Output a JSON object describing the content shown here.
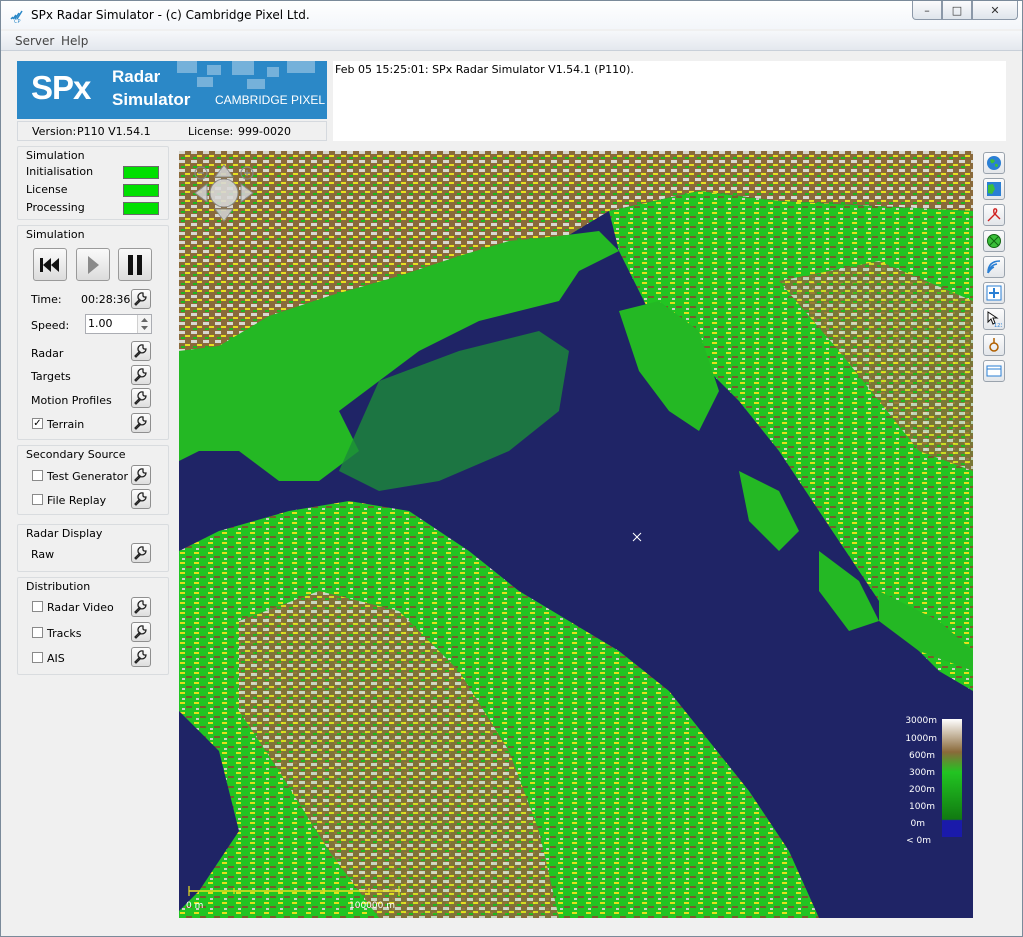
{
  "window": {
    "title": "SPx Radar Simulator - (c) Cambridge Pixel Ltd."
  },
  "menu": {
    "items": [
      "Server",
      "Help"
    ]
  },
  "logo": {
    "spx": "SPx",
    "line1": "Radar",
    "line2": "Simulator",
    "company": "CAMBRIDGE PIXEL"
  },
  "version": {
    "version_label": "Version:",
    "version_value": "P110 V1.54.1",
    "license_label": "License:",
    "license_value": "999-0020"
  },
  "log": {
    "lines": [
      "Feb 05 15:25:01: SPx Radar Simulator V1.54.1 (P110)."
    ]
  },
  "status": {
    "title": "Simulation",
    "items": [
      {
        "label": "Initialisation",
        "color": "#00e000"
      },
      {
        "label": "License",
        "color": "#00e000"
      },
      {
        "label": "Processing",
        "color": "#00e000"
      }
    ]
  },
  "simulation": {
    "title": "Simulation",
    "time_label": "Time:",
    "time_value": "00:28:36",
    "speed_label": "Speed:",
    "speed_value": "1.00",
    "radar_label": "Radar",
    "targets_label": "Targets",
    "motion_label": "Motion Profiles",
    "terrain_label": "Terrain",
    "terrain_checked": true
  },
  "secondary": {
    "title": "Secondary Source",
    "test_label": "Test Generator",
    "file_label": "File Replay"
  },
  "display": {
    "title": "Radar Display",
    "raw_label": "Raw"
  },
  "distribution": {
    "title": "Distribution",
    "video_label": "Radar Video",
    "tracks_label": "Tracks",
    "ais_label": "AIS"
  },
  "legend": {
    "labels": [
      "3000m",
      "1000m",
      "600m",
      "300m",
      "200m",
      "100m",
      "0m",
      "< 0m"
    ]
  },
  "scale": {
    "start": "0 m",
    "end": "100000 m"
  },
  "colors": {
    "sea": "#1f2466",
    "land_low": "#1fc21f",
    "land_mid": "#7a5c2e",
    "land_high": "#c8c8c0",
    "highlight": "#e8e020"
  }
}
